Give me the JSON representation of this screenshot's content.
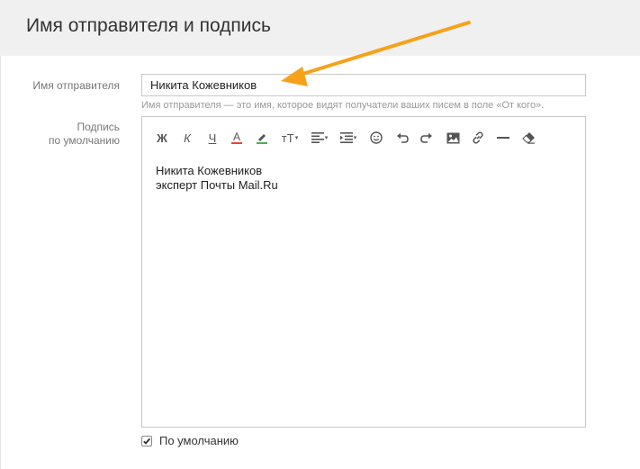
{
  "header": {
    "title": "Имя отправителя и подпись"
  },
  "form": {
    "sender_name_label": "Имя отправителя",
    "sender_name_value": "Никита Кожевников",
    "sender_name_hint": "Имя отправителя — это имя, которое видят получатели ваших писем в поле «От кого».",
    "signature_label_line1": "Подпись",
    "signature_label_line2": "по умолчанию",
    "default_checkbox_label": "По умолчанию",
    "default_checked": true
  },
  "toolbar": {
    "bold": "Ж",
    "italic": "К",
    "underline": "Ч",
    "text_color": "A",
    "font_size": "тТ",
    "caret": "▾"
  },
  "signature": {
    "line1": "Никита Кожевников",
    "line2": "эксперт Почты Mail.Ru"
  },
  "colors": {
    "text_color_bar": "#e8442c",
    "bg_color_bar": "#4caf50",
    "annotation_arrow": "#f5a21b"
  }
}
